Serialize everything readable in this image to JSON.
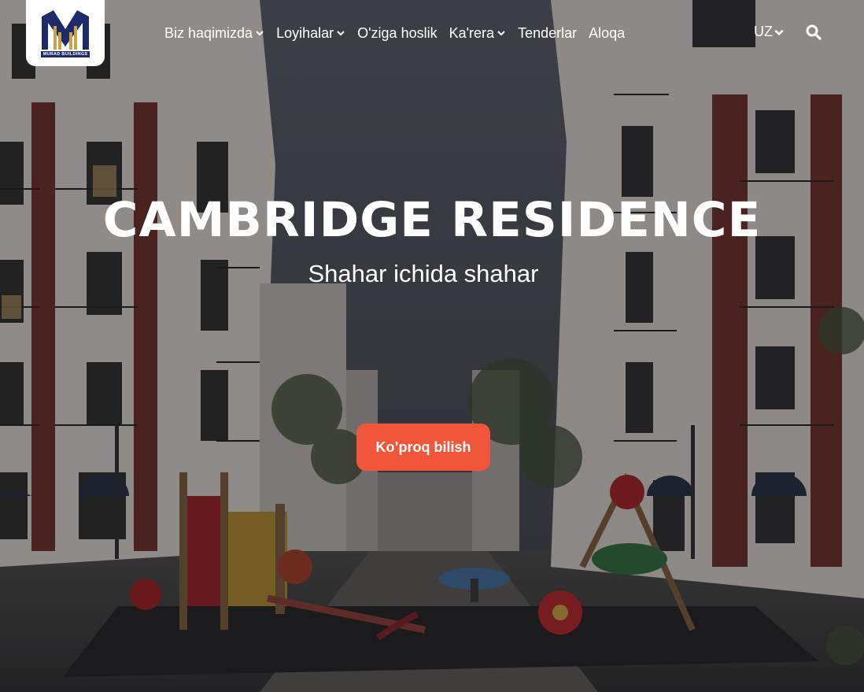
{
  "brand": {
    "logo_text": "MURAD BUILDINGS",
    "logo_color": "#1f2a6b",
    "logo_accent": "#c9a24a"
  },
  "nav": {
    "items": [
      {
        "label": "Biz haqimizda",
        "has_dropdown": true
      },
      {
        "label": "Loyihalar",
        "has_dropdown": true
      },
      {
        "label": "O'ziga hoslik",
        "has_dropdown": false
      },
      {
        "label": "Ka'rera",
        "has_dropdown": true
      },
      {
        "label": "Tenderlar",
        "has_dropdown": false
      },
      {
        "label": "Aloqa",
        "has_dropdown": false
      }
    ],
    "language": "UZ",
    "search_icon": "search-icon"
  },
  "hero": {
    "title": "CAMBRIDGE RESIDENCE",
    "subtitle": "Shahar ichida shahar",
    "cta_label": "Ko’proq bilish",
    "cta_color": "#f1563a",
    "background_image": "residential-street-playground"
  }
}
